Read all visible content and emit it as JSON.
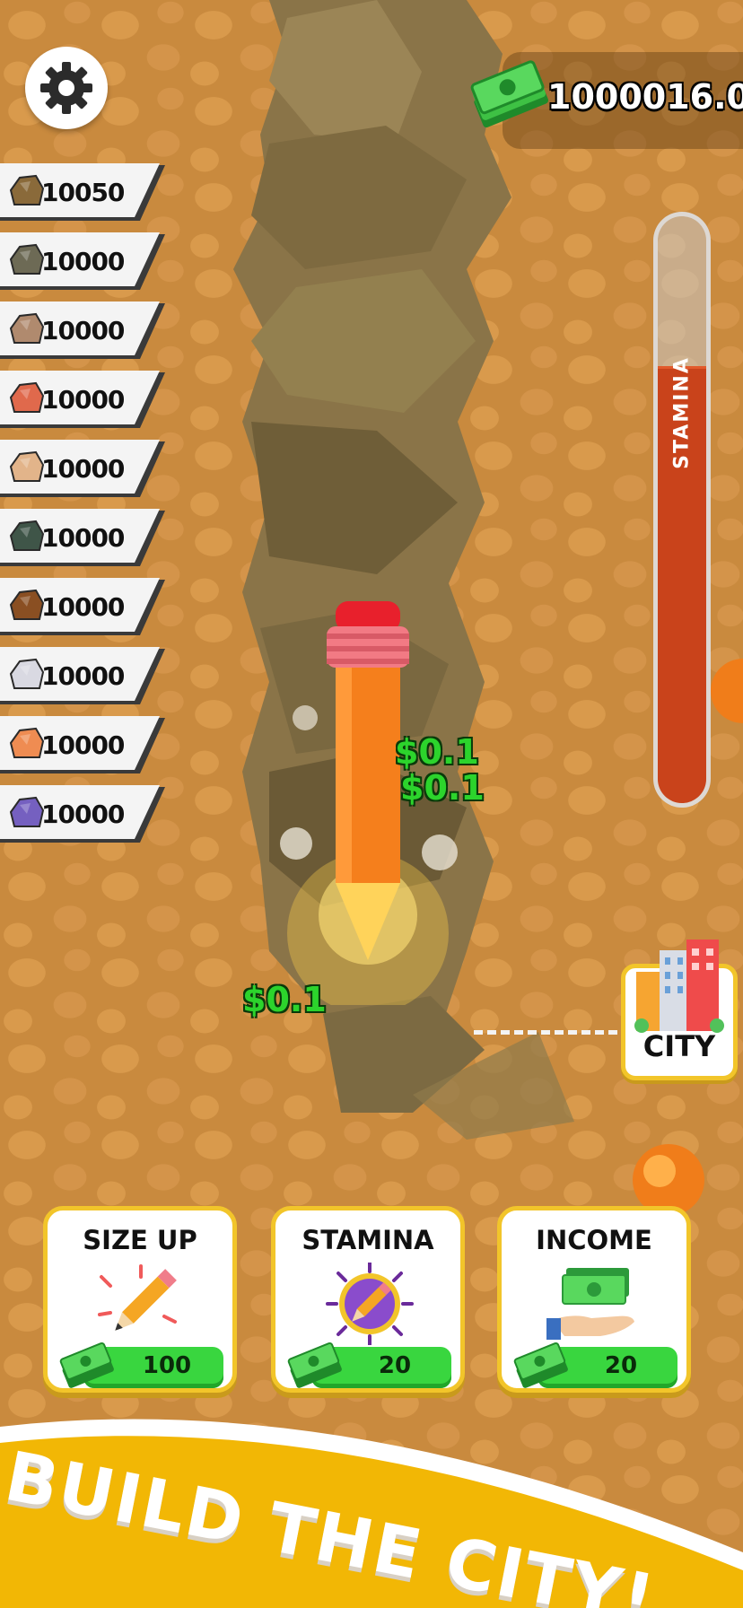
{
  "settings": {
    "icon": "gear-icon"
  },
  "money": {
    "icon": "cash-stack-icon",
    "value": "1000016.0"
  },
  "resources": [
    {
      "name": "brown-ore-icon",
      "color": "#8a6a3a",
      "count": "10050"
    },
    {
      "name": "gray-ore-icon",
      "color": "#6d6a55",
      "count": "10000"
    },
    {
      "name": "tan-stone-icon",
      "color": "#b08a6e",
      "count": "10000"
    },
    {
      "name": "red-stone-icon",
      "color": "#e0694c",
      "count": "10000"
    },
    {
      "name": "beige-stone-icon",
      "color": "#e2b48a",
      "count": "10000"
    },
    {
      "name": "dark-green-stone-icon",
      "color": "#3f5548",
      "count": "10000"
    },
    {
      "name": "brown-stone-icon",
      "color": "#8a4f22",
      "count": "10000"
    },
    {
      "name": "white-stone-icon",
      "color": "#d9d9e2",
      "count": "10000"
    },
    {
      "name": "orange-stone-icon",
      "color": "#ef8c52",
      "count": "10000"
    },
    {
      "name": "purple-stone-icon",
      "color": "#7560c0",
      "count": "10000"
    }
  ],
  "stamina": {
    "label": "STAMINA",
    "level": 0.74
  },
  "earnings": [
    "$0.1",
    "$0.1",
    "$0.1"
  ],
  "city": {
    "label": "CITY",
    "icon": "city-buildings-icon"
  },
  "cards": [
    {
      "title": "SIZE UP",
      "icon": "pencil-icon",
      "price": "100"
    },
    {
      "title": "STAMINA",
      "icon": "pencil-badge-icon",
      "price": "20"
    },
    {
      "title": "INCOME",
      "icon": "money-hand-icon",
      "price": "20"
    }
  ],
  "banner": {
    "text": "BUILD THE CITY!"
  },
  "colors": {
    "accent": "#f2c52a",
    "money": "#39d63f",
    "stamina": "#c9431b"
  }
}
